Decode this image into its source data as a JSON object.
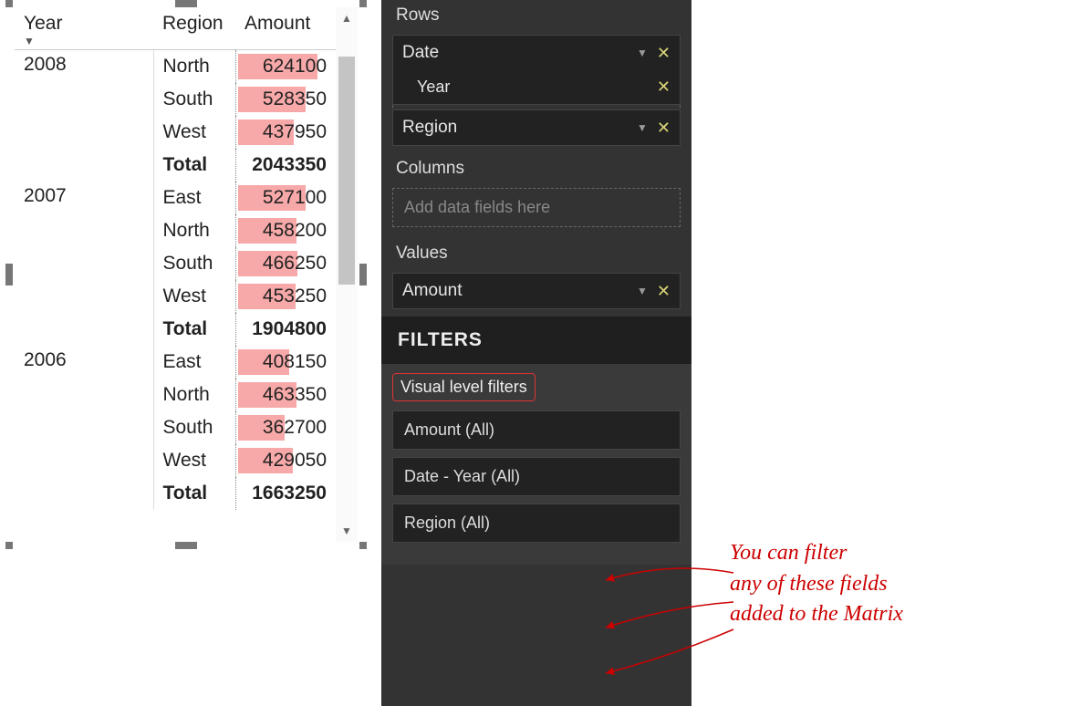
{
  "matrix": {
    "headers": {
      "year": "Year",
      "region": "Region",
      "amount": "Amount"
    },
    "sort_indicator": "▼",
    "groups": [
      {
        "year": "2008",
        "rows": [
          {
            "region": "North",
            "amount": "624100",
            "barpct": 80
          },
          {
            "region": "South",
            "amount": "528350",
            "barpct": 68
          },
          {
            "region": "West",
            "amount": "437950",
            "barpct": 56
          }
        ],
        "total_label": "Total",
        "total_amount": "2043350"
      },
      {
        "year": "2007",
        "rows": [
          {
            "region": "East",
            "amount": "527100",
            "barpct": 68
          },
          {
            "region": "North",
            "amount": "458200",
            "barpct": 59
          },
          {
            "region": "South",
            "amount": "466250",
            "barpct": 60
          },
          {
            "region": "West",
            "amount": "453250",
            "barpct": 58
          }
        ],
        "total_label": "Total",
        "total_amount": "1904800"
      },
      {
        "year": "2006",
        "rows": [
          {
            "region": "East",
            "amount": "408150",
            "barpct": 52
          },
          {
            "region": "North",
            "amount": "463350",
            "barpct": 59
          },
          {
            "region": "South",
            "amount": "362700",
            "barpct": 47
          },
          {
            "region": "West",
            "amount": "429050",
            "barpct": 55
          }
        ],
        "total_label": "Total",
        "total_amount": "1663250"
      }
    ]
  },
  "panel": {
    "rows_label": "Rows",
    "row_fields": {
      "date": "Date",
      "year": "Year",
      "region": "Region"
    },
    "columns_label": "Columns",
    "columns_placeholder": "Add data fields here",
    "values_label": "Values",
    "value_field": "Amount",
    "filters_header": "FILTERS",
    "vlf_label": "Visual level filters",
    "filters": {
      "amount": "Amount  (All)",
      "date_year": "Date - Year  (All)",
      "region": "Region  (All)"
    }
  },
  "annotation": {
    "line1": "You can filter",
    "line2": "any of these fields",
    "line3": "added to the Matrix"
  }
}
